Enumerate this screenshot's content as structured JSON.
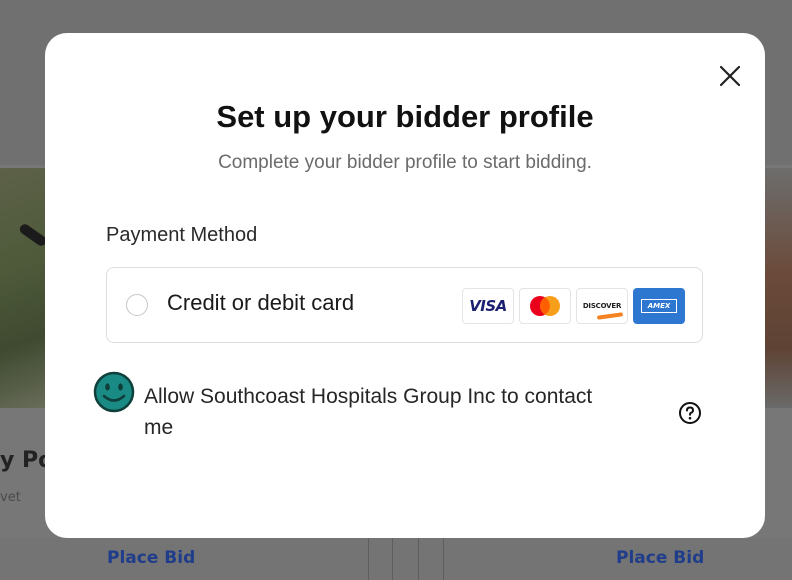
{
  "modal": {
    "title": "Set up your bidder profile",
    "subtitle": "Complete your bidder profile to start bidding.",
    "payment_section_label": "Payment Method",
    "payment_option": {
      "label": "Credit or debit card",
      "selected": false,
      "card_brands": [
        {
          "name": "visa",
          "text": "VISA"
        },
        {
          "name": "mastercard"
        },
        {
          "name": "discover",
          "text": "DISCOVER"
        },
        {
          "name": "amex",
          "text": "AMEX"
        }
      ]
    },
    "consent": {
      "label": "Allow Southcoast Hospitals Group Inc to contact me",
      "icon": "smiley-face-icon"
    },
    "icons": {
      "close": "close-icon",
      "help": "question-circle-icon"
    }
  },
  "background": {
    "card_left_title": "y Po",
    "card_left_sub": "vet",
    "place_bid_buttons": [
      "Place Bid",
      "Place Bid"
    ]
  },
  "colors": {
    "overlay": "#777777",
    "modal_bg": "#ffffff",
    "title": "#111111",
    "subtitle": "#6b6b6b",
    "smiley": "#1a8a84",
    "amex": "#2e77d0",
    "visa": "#1a1f71",
    "place_bid": "#1f3d8a"
  }
}
